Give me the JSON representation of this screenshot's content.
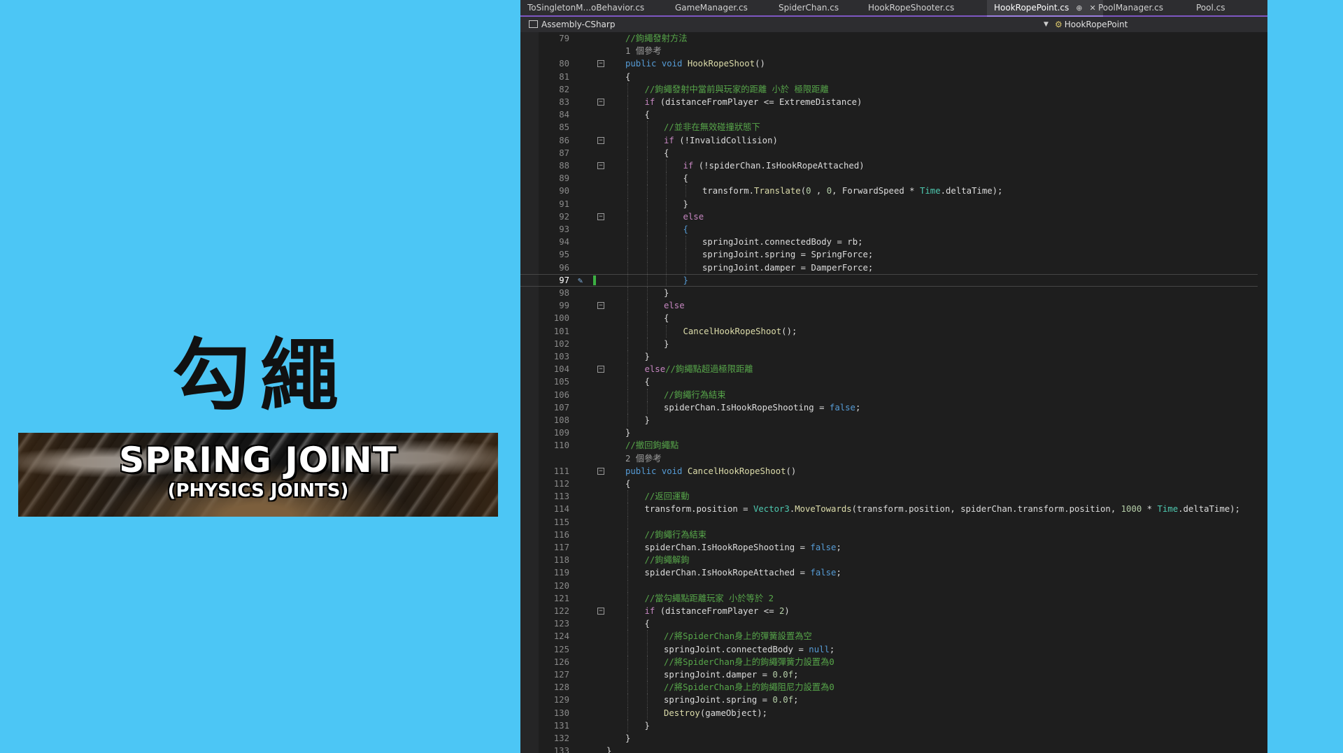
{
  "left_panel": {
    "title": "勾繩",
    "banner_title": "SPRING JOINT",
    "banner_subtitle": "(PHYSICS JOINTS)"
  },
  "tabs": [
    {
      "label": "ToSingletonM...oBehavior.cs",
      "active": false
    },
    {
      "label": "GameManager.cs",
      "active": false
    },
    {
      "label": "SpiderChan.cs",
      "active": false
    },
    {
      "label": "HookRopeShooter.cs",
      "active": false
    },
    {
      "label": "HookRopePoint.cs",
      "active": true,
      "pin_icon": "⊕",
      "close_icon": "✕"
    },
    {
      "label": "PoolManager.cs",
      "active": false
    },
    {
      "label": "Pool.cs",
      "active": false
    }
  ],
  "nav": {
    "project": "Assembly-CSharp",
    "class_member": "HookRopePoint"
  },
  "colors": {
    "background": "#4CC6F5",
    "editor_bg": "#1E1E1E",
    "keyword": "#569CD6",
    "control": "#C586C0",
    "comment": "#57A64A",
    "method": "#DCDCAA",
    "type": "#4EC9B0",
    "number": "#B5CEA8",
    "accent": "#7E57C2"
  },
  "code_lines": [
    {
      "n": "79",
      "indent": 1,
      "tokens": [
        [
          "cm",
          "//鉤繩發射方法"
        ]
      ]
    },
    {
      "n": "",
      "indent": 1,
      "ref": true,
      "tokens": [
        [
          "ref",
          "1 個參考"
        ]
      ]
    },
    {
      "n": "80",
      "indent": 1,
      "fold": true,
      "tokens": [
        [
          "k",
          "public "
        ],
        [
          "k",
          "void "
        ],
        [
          "m",
          "HookRopeShoot"
        ],
        [
          "",
          "()"
        ]
      ]
    },
    {
      "n": "81",
      "indent": 1,
      "tokens": [
        [
          "",
          "{"
        ]
      ]
    },
    {
      "n": "82",
      "indent": 2,
      "tokens": [
        [
          "cm",
          "//鉤繩發射中當前與玩家的距離 小於 極限距離"
        ]
      ]
    },
    {
      "n": "83",
      "indent": 2,
      "fold": true,
      "tokens": [
        [
          "c",
          "if "
        ],
        [
          "",
          "(distanceFromPlayer <= ExtremeDistance)"
        ]
      ]
    },
    {
      "n": "84",
      "indent": 2,
      "tokens": [
        [
          "",
          "{"
        ]
      ]
    },
    {
      "n": "85",
      "indent": 3,
      "tokens": [
        [
          "cm",
          "//並非在無效碰撞狀態下"
        ]
      ]
    },
    {
      "n": "86",
      "indent": 3,
      "fold": true,
      "tokens": [
        [
          "c",
          "if "
        ],
        [
          "",
          "(!InvalidCollision)"
        ]
      ]
    },
    {
      "n": "87",
      "indent": 3,
      "tokens": [
        [
          "",
          "{"
        ]
      ]
    },
    {
      "n": "88",
      "indent": 4,
      "fold": true,
      "tokens": [
        [
          "c",
          "if "
        ],
        [
          "",
          "(!spiderChan.IsHookRopeAttached)"
        ]
      ]
    },
    {
      "n": "89",
      "indent": 4,
      "tokens": [
        [
          "",
          "{"
        ]
      ]
    },
    {
      "n": "90",
      "indent": 5,
      "tokens": [
        [
          "",
          "transform."
        ],
        [
          "m",
          "Translate"
        ],
        [
          "",
          "("
        ],
        [
          "n",
          "0"
        ],
        [
          "",
          " , "
        ],
        [
          "n",
          "0"
        ],
        [
          "",
          ", ForwardSpeed * "
        ],
        [
          "t",
          "Time"
        ],
        [
          "",
          ".deltaTime);"
        ]
      ]
    },
    {
      "n": "91",
      "indent": 4,
      "tokens": [
        [
          "",
          "}"
        ]
      ]
    },
    {
      "n": "92",
      "indent": 4,
      "fold": true,
      "tokens": [
        [
          "c",
          "else"
        ]
      ]
    },
    {
      "n": "93",
      "indent": 4,
      "tokens": [
        [
          "k",
          "{"
        ]
      ]
    },
    {
      "n": "94",
      "indent": 5,
      "tokens": [
        [
          "",
          "springJoint.connectedBody = rb;"
        ]
      ]
    },
    {
      "n": "95",
      "indent": 5,
      "tokens": [
        [
          "",
          "springJoint.spring = SpringForce;"
        ]
      ]
    },
    {
      "n": "96",
      "indent": 5,
      "tokens": [
        [
          "",
          "springJoint.damper = DamperForce;"
        ]
      ]
    },
    {
      "n": "97",
      "indent": 4,
      "cur": true,
      "tokens": [
        [
          "k",
          "}"
        ]
      ]
    },
    {
      "n": "98",
      "indent": 3,
      "tokens": [
        [
          "",
          "}"
        ]
      ]
    },
    {
      "n": "99",
      "indent": 3,
      "fold": true,
      "tokens": [
        [
          "c",
          "else"
        ]
      ]
    },
    {
      "n": "100",
      "indent": 3,
      "tokens": [
        [
          "",
          "{"
        ]
      ]
    },
    {
      "n": "101",
      "indent": 4,
      "tokens": [
        [
          "m",
          "CancelHookRopeShoot"
        ],
        [
          "",
          "();"
        ]
      ]
    },
    {
      "n": "102",
      "indent": 3,
      "tokens": [
        [
          "",
          "}"
        ]
      ]
    },
    {
      "n": "103",
      "indent": 2,
      "tokens": [
        [
          "",
          "}"
        ]
      ]
    },
    {
      "n": "104",
      "indent": 2,
      "fold": true,
      "tokens": [
        [
          "c",
          "else"
        ],
        [
          "cm",
          "//鉤繩點超過極限距離"
        ]
      ]
    },
    {
      "n": "105",
      "indent": 2,
      "tokens": [
        [
          "",
          "{"
        ]
      ]
    },
    {
      "n": "106",
      "indent": 3,
      "tokens": [
        [
          "cm",
          "//鉤繩行為結束"
        ]
      ]
    },
    {
      "n": "107",
      "indent": 3,
      "tokens": [
        [
          "",
          "spiderChan.IsHookRopeShooting = "
        ],
        [
          "k",
          "false"
        ],
        [
          "",
          ";"
        ]
      ]
    },
    {
      "n": "108",
      "indent": 2,
      "tokens": [
        [
          "",
          "}"
        ]
      ]
    },
    {
      "n": "109",
      "indent": 1,
      "tokens": [
        [
          "",
          "}"
        ]
      ]
    },
    {
      "n": "110",
      "indent": 1,
      "tokens": [
        [
          "cm",
          "//撤回鉤繩點"
        ]
      ]
    },
    {
      "n": "",
      "indent": 1,
      "ref": true,
      "tokens": [
        [
          "ref",
          "2 個參考"
        ]
      ]
    },
    {
      "n": "111",
      "indent": 1,
      "fold": true,
      "tokens": [
        [
          "k",
          "public "
        ],
        [
          "k",
          "void "
        ],
        [
          "m",
          "CancelHookRopeShoot"
        ],
        [
          "",
          "()"
        ]
      ]
    },
    {
      "n": "112",
      "indent": 1,
      "tokens": [
        [
          "",
          "{"
        ]
      ]
    },
    {
      "n": "113",
      "indent": 2,
      "tokens": [
        [
          "cm",
          "//返回運動"
        ]
      ]
    },
    {
      "n": "114",
      "indent": 2,
      "tokens": [
        [
          "",
          "transform.position = "
        ],
        [
          "t",
          "Vector3"
        ],
        [
          "",
          "."
        ],
        [
          "m",
          "MoveTowards"
        ],
        [
          "",
          "(transform.position, spiderChan.transform.position, "
        ],
        [
          "n",
          "1000"
        ],
        [
          "",
          " * "
        ],
        [
          "t",
          "Time"
        ],
        [
          "",
          ".deltaTime);"
        ]
      ]
    },
    {
      "n": "115",
      "indent": 2,
      "tokens": []
    },
    {
      "n": "116",
      "indent": 2,
      "tokens": [
        [
          "cm",
          "//鉤繩行為結束"
        ]
      ]
    },
    {
      "n": "117",
      "indent": 2,
      "tokens": [
        [
          "",
          "spiderChan.IsHookRopeShooting = "
        ],
        [
          "k",
          "false"
        ],
        [
          "",
          ";"
        ]
      ]
    },
    {
      "n": "118",
      "indent": 2,
      "tokens": [
        [
          "cm",
          "//鉤繩解鉤"
        ]
      ]
    },
    {
      "n": "119",
      "indent": 2,
      "tokens": [
        [
          "",
          "spiderChan.IsHookRopeAttached = "
        ],
        [
          "k",
          "false"
        ],
        [
          "",
          ";"
        ]
      ]
    },
    {
      "n": "120",
      "indent": 2,
      "tokens": []
    },
    {
      "n": "121",
      "indent": 2,
      "tokens": [
        [
          "cm",
          "//當勾繩點距離玩家 小於等於 2"
        ]
      ]
    },
    {
      "n": "122",
      "indent": 2,
      "fold": true,
      "tokens": [
        [
          "c",
          "if "
        ],
        [
          "",
          "(distanceFromPlayer <= "
        ],
        [
          "n",
          "2"
        ],
        [
          "",
          ")"
        ]
      ]
    },
    {
      "n": "123",
      "indent": 2,
      "tokens": [
        [
          "",
          "{"
        ]
      ]
    },
    {
      "n": "124",
      "indent": 3,
      "tokens": [
        [
          "cm",
          "//將SpiderChan身上的彈簧設置為空"
        ]
      ]
    },
    {
      "n": "125",
      "indent": 3,
      "tokens": [
        [
          "",
          "springJoint.connectedBody = "
        ],
        [
          "k",
          "null"
        ],
        [
          "",
          ";"
        ]
      ]
    },
    {
      "n": "126",
      "indent": 3,
      "tokens": [
        [
          "cm",
          "//將SpiderChan身上的鉤繩彈簧力設置為0"
        ]
      ]
    },
    {
      "n": "127",
      "indent": 3,
      "tokens": [
        [
          "",
          "springJoint.damper = "
        ],
        [
          "n",
          "0.0f"
        ],
        [
          "",
          ";"
        ]
      ]
    },
    {
      "n": "128",
      "indent": 3,
      "tokens": [
        [
          "cm",
          "//將SpiderChan身上的鉤繩阻尼力設置為0"
        ]
      ]
    },
    {
      "n": "129",
      "indent": 3,
      "tokens": [
        [
          "",
          "springJoint.spring = "
        ],
        [
          "n",
          "0.0f"
        ],
        [
          "",
          ";"
        ]
      ]
    },
    {
      "n": "130",
      "indent": 3,
      "tokens": [
        [
          "m",
          "Destroy"
        ],
        [
          "",
          "(gameObject);"
        ]
      ]
    },
    {
      "n": "131",
      "indent": 2,
      "tokens": [
        [
          "",
          "}"
        ]
      ]
    },
    {
      "n": "132",
      "indent": 1,
      "tokens": [
        [
          "",
          "}"
        ]
      ]
    },
    {
      "n": "133",
      "indent": 0,
      "tokens": [
        [
          "",
          "}"
        ]
      ]
    }
  ]
}
